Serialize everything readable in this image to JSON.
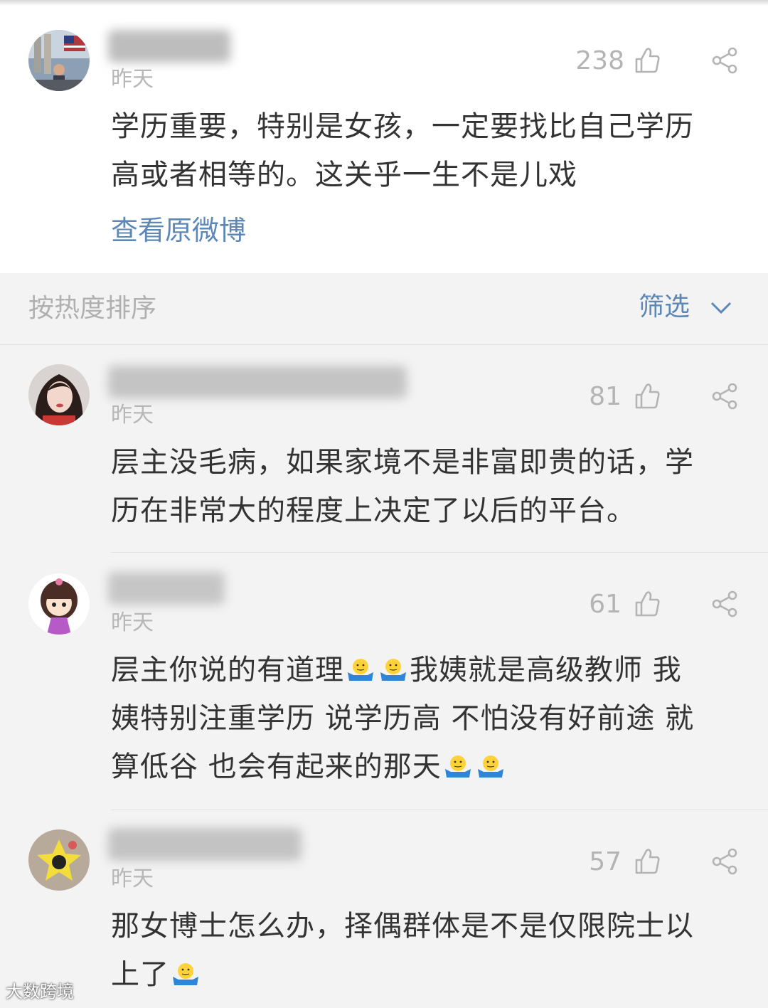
{
  "original_post": {
    "time": "昨天",
    "likes": "238",
    "text_line1": "学历重要，特别是女孩，一定要找比自己学历",
    "text_line2": "高或者相等的。这关乎一生不是儿戏",
    "view_original_link": "查看原微博"
  },
  "sort_bar": {
    "sort_label": "按热度排序",
    "filter_label": "筛选",
    "filter_icon": "chevron-down-icon"
  },
  "comments": [
    {
      "time": "昨天",
      "likes": "81",
      "text_line1": "层主没毛病，如果家境不是非富即贵的话，学",
      "text_line2": "历在非常大的程度上决定了以后的平台。"
    },
    {
      "time": "昨天",
      "likes": "61",
      "text_line1a": "层主你说的有道理",
      "text_line1b": "我姨就是高级教师 我",
      "text_line2": "姨特别注重学历 说学历高 不怕没有好前途 就",
      "text_line3": "算低谷 也会有起来的那天"
    },
    {
      "time": "昨天",
      "likes": "57",
      "text_line1": "那女博士怎么办，择偶群体是不是仅限院士以",
      "text_line2": "上了"
    }
  ],
  "icons": {
    "like": "thumbs-up-icon",
    "share": "share-icon",
    "emoji": "shrug-emoji-icon"
  },
  "watermark": "大数跨境",
  "colors": {
    "link_blue": "#5d87b7",
    "text": "#333333",
    "muted": "#b4b4b4",
    "background": "#f3f3f3"
  }
}
